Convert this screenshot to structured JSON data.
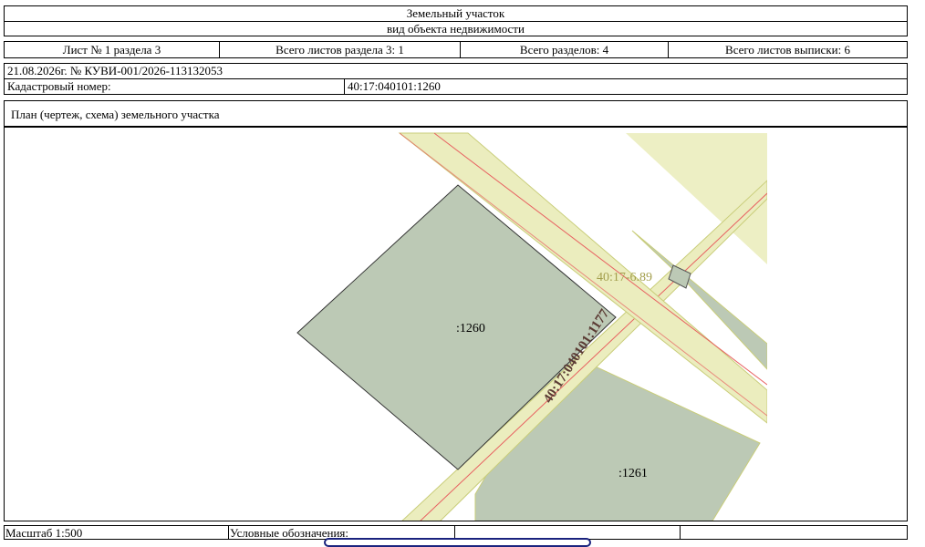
{
  "header": {
    "title": "Земельный участок",
    "subtitle": "вид объекта недвижимости"
  },
  "sheet_info": {
    "sheet": "Лист № 1 раздела 3",
    "total_sheets_section": "Всего листов раздела 3: 1",
    "total_sections": "Всего разделов: 4",
    "total_sheets_extract": "Всего листов выписки: 6"
  },
  "extract": {
    "date_number": "21.08.2026г. № КУВИ-001/2026-113132053",
    "cadastral_label": "Кадастровый номер:",
    "cadastral_value": "40:17:040101:1260"
  },
  "plan": {
    "title": "План (чертеж, схема) земельного участка",
    "labels": {
      "parcel_main": ":1260",
      "parcel_south": ":1261",
      "road_quarter": "40:17-6.89",
      "road_parcel": "40:17:040101:1177"
    },
    "colors": {
      "parcel_fill": "#bcc9b5",
      "road_fill": "#ebedbe",
      "road_border": "#c9cd7a",
      "red_line": "#e86060",
      "label_olive": "#a39e4c",
      "label_brown": "#5a3a33"
    }
  },
  "footer": {
    "scale": "Масштаб 1:500",
    "legend": "Условные обозначения:"
  }
}
